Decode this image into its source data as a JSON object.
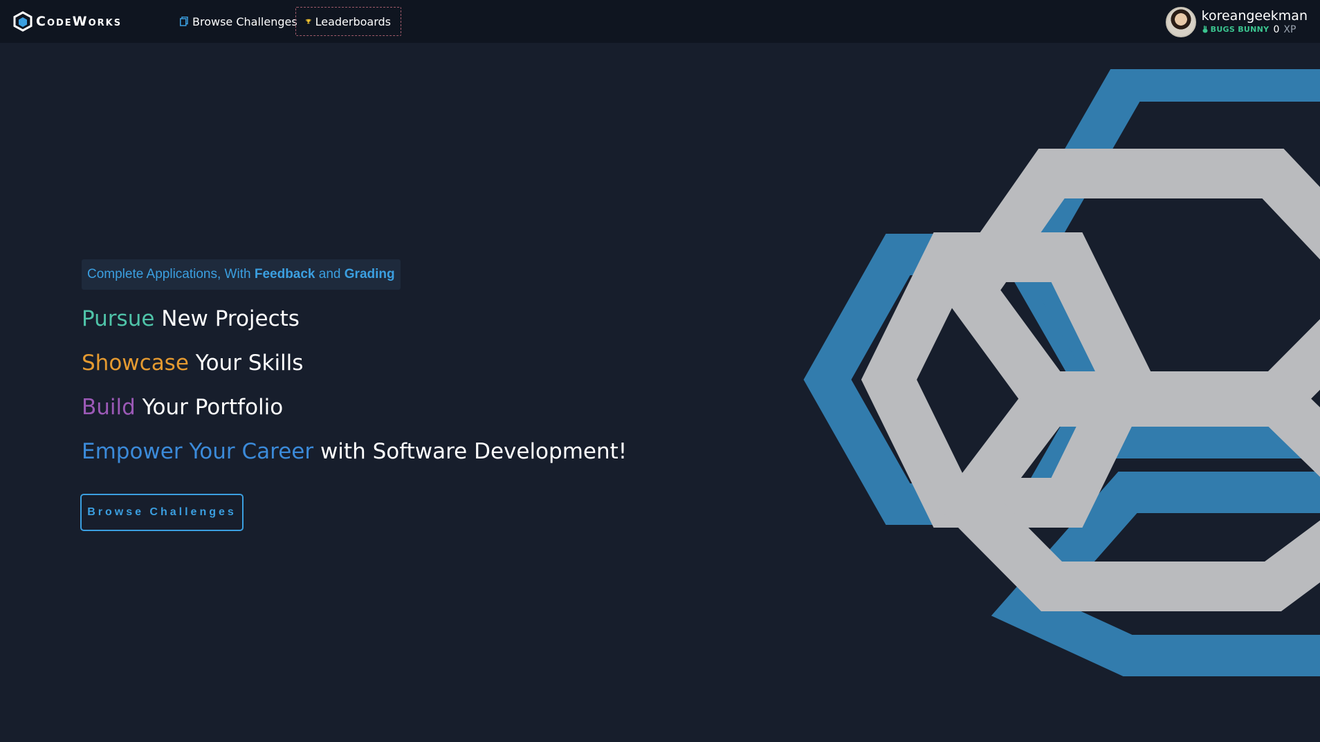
{
  "navbar": {
    "logo_text": "CodeWorks",
    "links": [
      {
        "label": "Browse Challenges",
        "icon": "copy-icon"
      },
      {
        "label": "Leaderboards",
        "icon": "trophy-icon"
      }
    ]
  },
  "user": {
    "username": "koreangeekman",
    "rank": "BUGS BUNNY",
    "xp_value": "0",
    "xp_label": "XP"
  },
  "hero": {
    "badge": {
      "prefix": "Complete Applications, With ",
      "feedback": "Feedback",
      "and": " and ",
      "grading": "Grading"
    },
    "lines": [
      {
        "colored": "Pursue",
        "rest": " New Projects"
      },
      {
        "colored": "Showcase",
        "rest": " Your Skills"
      },
      {
        "colored": "Build",
        "rest": " Your Portfolio"
      },
      {
        "colored": "Empower Your Career",
        "rest": " with Software Development!"
      }
    ],
    "cta_label": "Browse Challenges"
  },
  "colors": {
    "background": "#171e2c",
    "navbar": "#0f1520",
    "accent_blue": "#3b9fe0",
    "pursue": "#4fc3a8",
    "showcase": "#e59a30",
    "build": "#9b59b6",
    "empower": "#3b8ad9",
    "hex_gray": "#babbbe",
    "hex_blue": "#327cad"
  }
}
